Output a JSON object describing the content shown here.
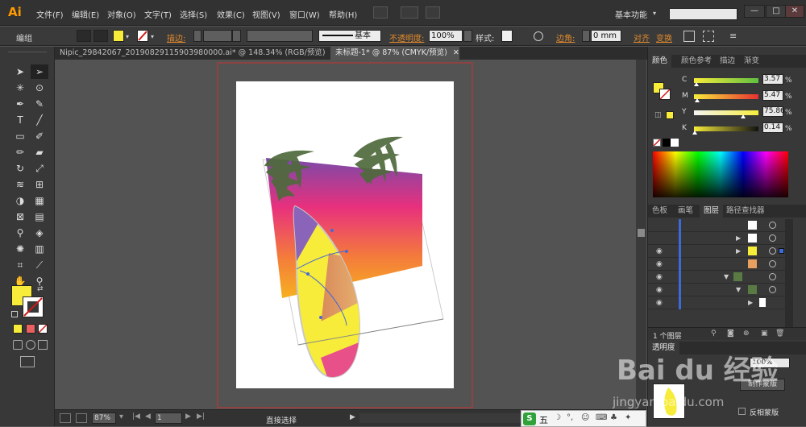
{
  "app": {
    "logo": "Ai",
    "workspace": "基本功能"
  },
  "menus": [
    "文件(F)",
    "编辑(E)",
    "对象(O)",
    "文字(T)",
    "选择(S)",
    "效果(C)",
    "视图(V)",
    "窗口(W)",
    "帮助(H)"
  ],
  "window_controls": {
    "minimize": "—",
    "restore": "□",
    "close": "✕"
  },
  "control_bar": {
    "mode_label": "编组",
    "stroke_label": "描边:",
    "stroke_style": "基本",
    "opacity_label": "不透明度:",
    "opacity_value": "100%",
    "style_label": "样式:",
    "corner_label": "边角:",
    "corner_value": "0 mm",
    "align_label": "对齐",
    "transform_label": "变换"
  },
  "doc_tabs": [
    {
      "label": "Nipic_29842067_20190829115903980000.ai* @ 148.34% (RGB/预览)",
      "close": "✕"
    },
    {
      "label": "未标题-1* @ 87% (CMYK/预览)",
      "close": "✕"
    }
  ],
  "colors": {
    "fill": "#f7ec3a",
    "accent": "#e08a2c",
    "artboard_border": "#d03434"
  },
  "color_panel": {
    "tabs": [
      "颜色",
      "颜色参考",
      "描边",
      "渐变"
    ],
    "channels": [
      {
        "label": "C",
        "value": "3.57",
        "unit": "%",
        "level": 0.04
      },
      {
        "label": "M",
        "value": "5.47",
        "unit": "%",
        "level": 0.05
      },
      {
        "label": "Y",
        "value": "75.86",
        "unit": "%",
        "level": 0.76
      },
      {
        "label": "K",
        "value": "0.14",
        "unit": "%",
        "level": 0.01
      }
    ]
  },
  "layers_panel": {
    "tabs": [
      "色板",
      "画笔",
      "图层",
      "路径查找器"
    ],
    "footer": "1 个图层"
  },
  "transparency_panel": {
    "tab": "透明度",
    "value": "100%",
    "make_mask": "制作蒙版",
    "invert_mask": "反相蒙版"
  },
  "status_bar": {
    "zoom": "87%",
    "page": "1",
    "tool": "直接选择"
  },
  "watermark": {
    "brand": "Bai du 经验",
    "url": "jingyan.baidu.com"
  },
  "ime_bar": {
    "mode": "五"
  }
}
